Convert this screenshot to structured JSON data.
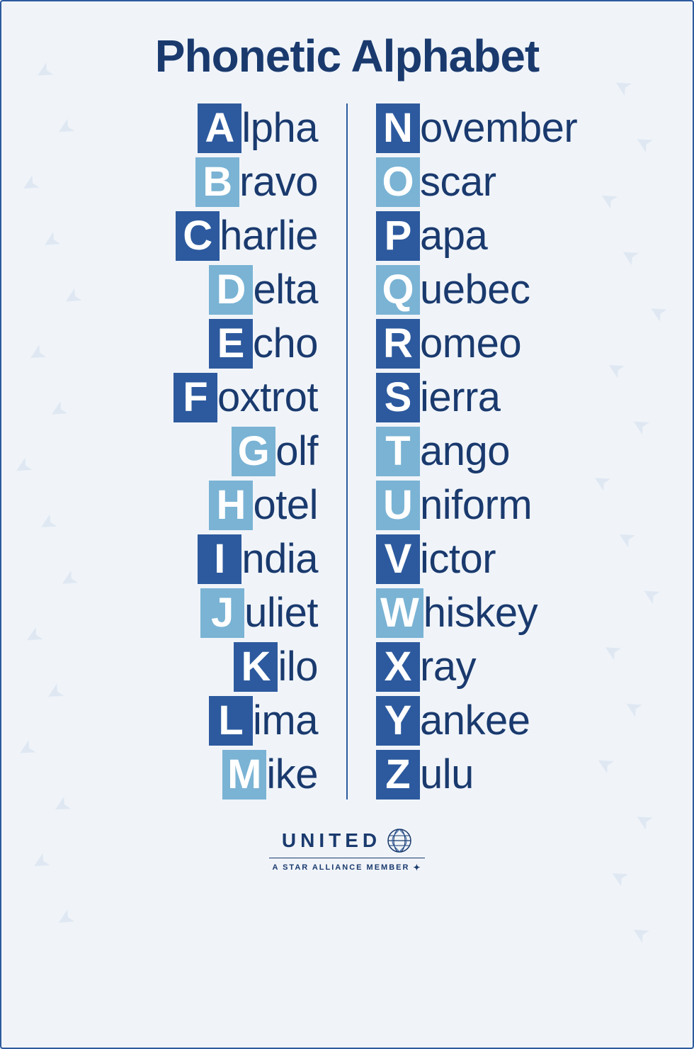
{
  "page": {
    "title": "Phonetic Alphabet",
    "border_color": "#2d5a9e",
    "background_color": "#f0f4f9"
  },
  "alphabet": {
    "left_column": [
      {
        "letter": "A",
        "rest": "lpha",
        "shade": "dark"
      },
      {
        "letter": "B",
        "rest": "ravo",
        "shade": "light"
      },
      {
        "letter": "C",
        "rest": "harlie",
        "shade": "dark"
      },
      {
        "letter": "D",
        "rest": "elta",
        "shade": "light"
      },
      {
        "letter": "E",
        "rest": "cho",
        "shade": "dark"
      },
      {
        "letter": "F",
        "rest": "oxtrot",
        "shade": "dark"
      },
      {
        "letter": "G",
        "rest": "olf",
        "shade": "light"
      },
      {
        "letter": "H",
        "rest": "otel",
        "shade": "light"
      },
      {
        "letter": "I",
        "rest": "ndia",
        "shade": "dark"
      },
      {
        "letter": "J",
        "rest": "uliet",
        "shade": "light"
      },
      {
        "letter": "K",
        "rest": "ilo",
        "shade": "dark"
      },
      {
        "letter": "L",
        "rest": "ima",
        "shade": "dark"
      },
      {
        "letter": "M",
        "rest": "ike",
        "shade": "light"
      }
    ],
    "right_column": [
      {
        "letter": "N",
        "rest": "ovember",
        "shade": "dark"
      },
      {
        "letter": "O",
        "rest": "scar",
        "shade": "light"
      },
      {
        "letter": "P",
        "rest": "apa",
        "shade": "dark"
      },
      {
        "letter": "Q",
        "rest": "uebec",
        "shade": "light"
      },
      {
        "letter": "R",
        "rest": "omeo",
        "shade": "dark"
      },
      {
        "letter": "S",
        "rest": "ierra",
        "shade": "dark"
      },
      {
        "letter": "T",
        "rest": "ango",
        "shade": "light"
      },
      {
        "letter": "U",
        "rest": "niform",
        "shade": "light"
      },
      {
        "letter": "V",
        "rest": "ictor",
        "shade": "dark"
      },
      {
        "letter": "W",
        "rest": "hiskey",
        "shade": "light"
      },
      {
        "letter": "X",
        "rest": "ray",
        "shade": "dark"
      },
      {
        "letter": "Y",
        "rest": "ankee",
        "shade": "dark"
      },
      {
        "letter": "Z",
        "rest": "ulu",
        "shade": "dark"
      }
    ]
  },
  "footer": {
    "brand": "UNITED",
    "tagline": "A STAR ALLIANCE MEMBER"
  }
}
